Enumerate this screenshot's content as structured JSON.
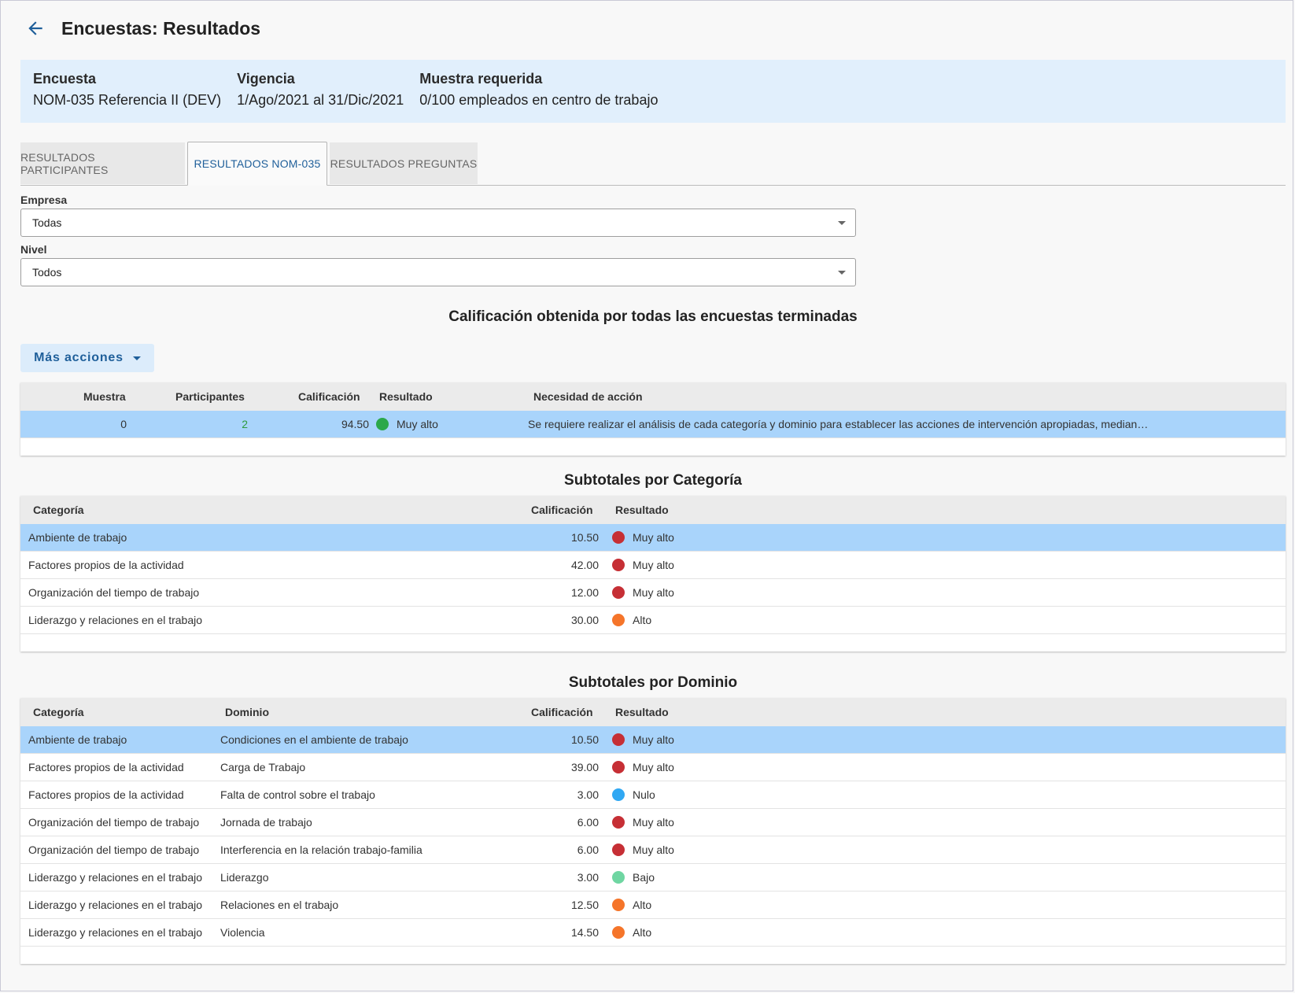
{
  "header": {
    "title": "Encuestas: Resultados"
  },
  "info": {
    "survey_label": "Encuesta",
    "survey_value": "NOM-035 Referencia II (DEV)",
    "validity_label": "Vigencia",
    "validity_value": "1/Ago/2021 al 31/Dic/2021",
    "sample_label": "Muestra requerida",
    "sample_value": "0/100 empleados en centro de trabajo"
  },
  "tabs": [
    {
      "label": "RESULTADOS PARTICIPANTES",
      "active": false
    },
    {
      "label": "RESULTADOS NOM-035",
      "active": true
    },
    {
      "label": "RESULTADOS PREGUNTAS",
      "active": false
    }
  ],
  "filters": {
    "company_label": "Empresa",
    "company_value": "Todas",
    "level_label": "Nivel",
    "level_value": "Todos"
  },
  "colors": {
    "muy_alto": "#c62f35",
    "alto": "#f5752a",
    "bajo": "#6fd6a2",
    "nulo": "#30a8f3",
    "muy_alto_green": "#2ca84a"
  },
  "summary": {
    "title": "Calificación obtenida por todas las encuestas terminadas",
    "more_actions": "Más acciones",
    "columns": [
      "Muestra",
      "Participantes",
      "Calificación",
      "Resultado",
      "Necesidad de acción"
    ],
    "row": {
      "sample": "0",
      "participants": "2",
      "score": "94.50",
      "result": "Muy alto",
      "result_color": "#2ca84a",
      "action": "Se requiere realizar el análisis de cada categoría y dominio para establecer las acciones de intervención apropiadas, median…"
    }
  },
  "by_category": {
    "title": "Subtotales por Categoría",
    "columns": [
      "Categoría",
      "Calificación",
      "Resultado"
    ],
    "rows": [
      {
        "category": "Ambiente de trabajo",
        "score": "10.50",
        "result": "Muy alto",
        "color": "#c62f35"
      },
      {
        "category": "Factores propios de la actividad",
        "score": "42.00",
        "result": "Muy alto",
        "color": "#c62f35"
      },
      {
        "category": "Organización del tiempo de trabajo",
        "score": "12.00",
        "result": "Muy alto",
        "color": "#c62f35"
      },
      {
        "category": "Liderazgo y relaciones en el trabajo",
        "score": "30.00",
        "result": "Alto",
        "color": "#f5752a"
      }
    ]
  },
  "by_domain": {
    "title": "Subtotales por Dominio",
    "columns": [
      "Categoría",
      "Dominio",
      "Calificación",
      "Resultado"
    ],
    "rows": [
      {
        "category": "Ambiente de trabajo",
        "domain": "Condiciones en el ambiente de trabajo",
        "score": "10.50",
        "result": "Muy alto",
        "color": "#c62f35"
      },
      {
        "category": "Factores propios de la actividad",
        "domain": "Carga de Trabajo",
        "score": "39.00",
        "result": "Muy alto",
        "color": "#c62f35"
      },
      {
        "category": "Factores propios de la actividad",
        "domain": "Falta de control sobre el trabajo",
        "score": "3.00",
        "result": "Nulo",
        "color": "#30a8f3"
      },
      {
        "category": "Organización del tiempo de trabajo",
        "domain": "Jornada de trabajo",
        "score": "6.00",
        "result": "Muy alto",
        "color": "#c62f35"
      },
      {
        "category": "Organización del tiempo de trabajo",
        "domain": "Interferencia en la relación trabajo-familia",
        "score": "6.00",
        "result": "Muy alto",
        "color": "#c62f35"
      },
      {
        "category": "Liderazgo y relaciones en el trabajo",
        "domain": "Liderazgo",
        "score": "3.00",
        "result": "Bajo",
        "color": "#6fd6a2"
      },
      {
        "category": "Liderazgo y relaciones en el trabajo",
        "domain": "Relaciones en el trabajo",
        "score": "12.50",
        "result": "Alto",
        "color": "#f5752a"
      },
      {
        "category": "Liderazgo y relaciones en el trabajo",
        "domain": "Violencia",
        "score": "14.50",
        "result": "Alto",
        "color": "#f5752a"
      }
    ]
  }
}
